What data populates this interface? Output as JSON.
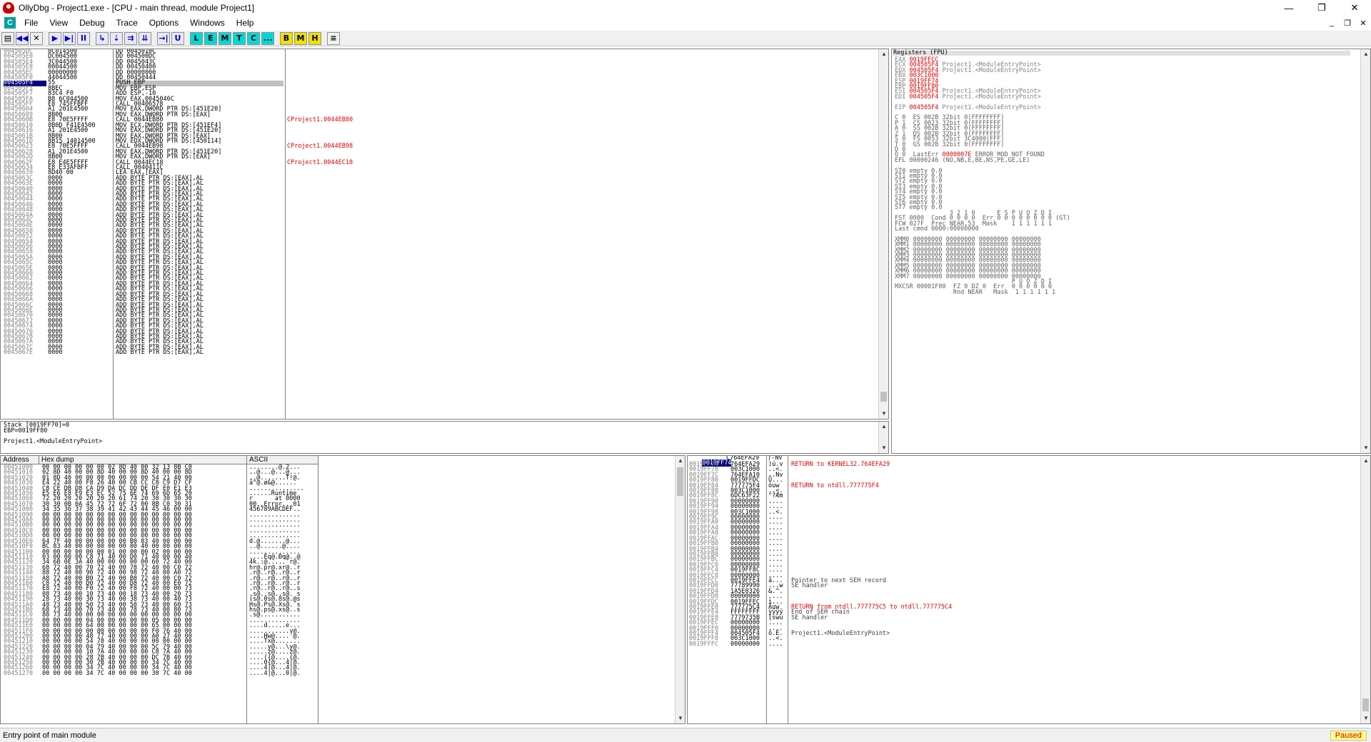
{
  "window": {
    "title": "OllyDbg - Project1.exe - [CPU - main thread, module Project1]"
  },
  "menu": [
    "File",
    "View",
    "Debug",
    "Trace",
    "Options",
    "Windows",
    "Help"
  ],
  "toolbar": {
    "blue": [
      "◀◀",
      "✕",
      "▶",
      "▶|",
      "II",
      "↳",
      "⇣",
      "⇉",
      "⇊",
      "→|",
      "U"
    ],
    "cyan": [
      "L",
      "E",
      "M",
      "T",
      "C",
      "..."
    ],
    "yellow": [
      "B",
      "M",
      "H"
    ],
    "list": "≡"
  },
  "cpu": {
    "current_address": "004505F4",
    "rows": [
      [
        "004505DC",
        "0C014500",
        "DD 0045010C",
        ""
      ],
      [
        "004505E0",
        "DC004500",
        "DD 004500DC",
        ""
      ],
      [
        "004505E4",
        "3C044500",
        "DD 0045043C",
        ""
      ],
      [
        "004505E8",
        "00044500",
        "DD 00450400",
        ""
      ],
      [
        "004505EC",
        "00000000",
        "DD 00000000",
        ""
      ],
      [
        "004505F0",
        "44044500",
        "DD 00450444",
        ""
      ],
      [
        "004505F4",
        "55",
        "PUSH EBP",
        ""
      ],
      [
        "004505F5",
        "8BEC",
        "MOV EBP,ESP",
        ""
      ],
      [
        "004505F7",
        "83C4 F0",
        "ADD ESP,-10",
        ""
      ],
      [
        "004505FA",
        "B8 6C044500",
        "MOV EAX,0045046C",
        ""
      ],
      [
        "004505FF",
        "E8 745FFBFF",
        "CALL 00406578",
        ""
      ],
      [
        "00450604",
        "A1 201E4500",
        "MOV EAX,DWORD PTR DS:[451E20]",
        ""
      ],
      [
        "00450609",
        "8B00",
        "MOV EAX,DWORD PTR DS:[EAX]",
        ""
      ],
      [
        "0045060B",
        "E8 70E5FFFF",
        "CALL 0044EB80",
        "Project1.0044EB80"
      ],
      [
        "00450610",
        "8B0D F41E4500",
        "MOV ECX,DWORD PTR DS:[451EF4]",
        ""
      ],
      [
        "00450616",
        "A1 201E4500",
        "MOV EAX,DWORD PTR DS:[451E20]",
        ""
      ],
      [
        "0045061B",
        "8B00",
        "MOV EAX,DWORD PTR DS:[EAX]",
        ""
      ],
      [
        "0045061D",
        "8B15 14014500",
        "MOV EDX,DWORD PTR DS:[450114]",
        ""
      ],
      [
        "00450623",
        "E8 70E5FFFF",
        "CALL 0044EB98",
        "Project1.0044EB98"
      ],
      [
        "00450628",
        "A1 201E4500",
        "MOV EAX,DWORD PTR DS:[451E20]",
        ""
      ],
      [
        "0045062D",
        "8B00",
        "MOV EAX,DWORD PTR DS:[EAX]",
        ""
      ],
      [
        "0045062F",
        "E8 E4E5FFFF",
        "CALL 0044EC18",
        "Project1.0044EC18"
      ],
      [
        "00450634",
        "E8 E33AFBFF",
        "CALL 0040411C",
        ""
      ],
      [
        "00450639",
        "8D40 00",
        "LEA EAX,[EAX]",
        ""
      ],
      [
        "0045063C",
        "0000",
        "ADD BYTE PTR DS:[EAX],AL",
        ""
      ],
      [
        "0045063E",
        "0000",
        "ADD BYTE PTR DS:[EAX],AL",
        ""
      ],
      [
        "00450640",
        "0000",
        "ADD BYTE PTR DS:[EAX],AL",
        ""
      ],
      [
        "00450642",
        "0000",
        "ADD BYTE PTR DS:[EAX],AL",
        ""
      ],
      [
        "00450644",
        "0000",
        "ADD BYTE PTR DS:[EAX],AL",
        ""
      ],
      [
        "00450646",
        "0000",
        "ADD BYTE PTR DS:[EAX],AL",
        ""
      ],
      [
        "00450648",
        "0000",
        "ADD BYTE PTR DS:[EAX],AL",
        ""
      ],
      [
        "0045064A",
        "0000",
        "ADD BYTE PTR DS:[EAX],AL",
        ""
      ],
      [
        "0045064C",
        "0000",
        "ADD BYTE PTR DS:[EAX],AL",
        ""
      ],
      [
        "0045064E",
        "0000",
        "ADD BYTE PTR DS:[EAX],AL",
        ""
      ],
      [
        "00450650",
        "0000",
        "ADD BYTE PTR DS:[EAX],AL",
        ""
      ],
      [
        "00450652",
        "0000",
        "ADD BYTE PTR DS:[EAX],AL",
        ""
      ],
      [
        "00450654",
        "0000",
        "ADD BYTE PTR DS:[EAX],AL",
        ""
      ],
      [
        "00450656",
        "0000",
        "ADD BYTE PTR DS:[EAX],AL",
        ""
      ],
      [
        "00450658",
        "0000",
        "ADD BYTE PTR DS:[EAX],AL",
        ""
      ],
      [
        "0045065A",
        "0000",
        "ADD BYTE PTR DS:[EAX],AL",
        ""
      ],
      [
        "0045065C",
        "0000",
        "ADD BYTE PTR DS:[EAX],AL",
        ""
      ],
      [
        "0045065E",
        "0000",
        "ADD BYTE PTR DS:[EAX],AL",
        ""
      ],
      [
        "00450660",
        "0000",
        "ADD BYTE PTR DS:[EAX],AL",
        ""
      ],
      [
        "00450662",
        "0000",
        "ADD BYTE PTR DS:[EAX],AL",
        ""
      ],
      [
        "00450664",
        "0000",
        "ADD BYTE PTR DS:[EAX],AL",
        ""
      ],
      [
        "00450666",
        "0000",
        "ADD BYTE PTR DS:[EAX],AL",
        ""
      ],
      [
        "00450668",
        "0000",
        "ADD BYTE PTR DS:[EAX],AL",
        ""
      ],
      [
        "0045066A",
        "0000",
        "ADD BYTE PTR DS:[EAX],AL",
        ""
      ],
      [
        "0045066C",
        "0000",
        "ADD BYTE PTR DS:[EAX],AL",
        ""
      ],
      [
        "0045066E",
        "0000",
        "ADD BYTE PTR DS:[EAX],AL",
        ""
      ],
      [
        "00450670",
        "0000",
        "ADD BYTE PTR DS:[EAX],AL",
        ""
      ],
      [
        "00450672",
        "0000",
        "ADD BYTE PTR DS:[EAX],AL",
        ""
      ],
      [
        "00450674",
        "0000",
        "ADD BYTE PTR DS:[EAX],AL",
        ""
      ],
      [
        "00450676",
        "0000",
        "ADD BYTE PTR DS:[EAX],AL",
        ""
      ],
      [
        "00450678",
        "0000",
        "ADD BYTE PTR DS:[EAX],AL",
        ""
      ],
      [
        "0045067A",
        "0000",
        "ADD BYTE PTR DS:[EAX],AL",
        ""
      ],
      [
        "0045067C",
        "0000",
        "ADD BYTE PTR DS:[EAX],AL",
        ""
      ],
      [
        "0045067E",
        "0000",
        "ADD BYTE PTR DS:[EAX],AL",
        ""
      ]
    ]
  },
  "info": {
    "lines": [
      "Stack [0019FF70]=0",
      "EBP=0019FF80",
      "",
      "Project1.<ModuleEntryPoint>"
    ]
  },
  "registers": {
    "header": "Registers (FPU)",
    "gp": [
      [
        "EAX",
        "0019FFCC",
        ""
      ],
      [
        "ECX",
        "004505F4",
        "Project1.<ModuleEntryPoint>"
      ],
      [
        "EDX",
        "004505F4",
        "Project1.<ModuleEntryPoint>"
      ],
      [
        "EBX",
        "003C1000",
        ""
      ],
      [
        "ESP",
        "0019FF74",
        ""
      ],
      [
        "EBP",
        "0019FF80",
        ""
      ],
      [
        "ESI",
        "004505F4",
        "Project1.<ModuleEntryPoint>"
      ],
      [
        "EDI",
        "004505F4",
        "Project1.<ModuleEntryPoint>"
      ]
    ],
    "eip": [
      "EIP",
      "004505F4",
      "Project1.<ModuleEntryPoint>"
    ],
    "flags": [
      "C 0  ES 002B 32bit 0(FFFFFFFF)",
      "P 1  CS 0023 32bit 0(FFFFFFFF)",
      "A 0  SS 002B 32bit 0(FFFFFFFF)",
      "Z 1  DS 002B 32bit 0(FFFFFFFF)",
      "S 0  FS 0053 32bit 3C4000(FFF)",
      "T 0  GS 002B 32bit 0(FFFFFFFF)",
      "D 0"
    ],
    "lasterr": {
      "prefix": "O 0  LastErr ",
      "code": "0000007E",
      "name": " ERROR_MOD_NOT_FOUND"
    },
    "efl": "EFL 00000246 (NO,NB,E,BE,NS,PE,GE,LE)",
    "st": [
      "ST0 empty 0.0",
      "ST1 empty 0.0",
      "ST2 empty 0.0",
      "ST3 empty 0.0",
      "ST4 empty 0.0",
      "ST5 empty 0.0",
      "ST6 empty 0.0",
      "ST7 empty 0.0"
    ],
    "fpu": [
      "               3 2 1 0      E S P U O Z D I",
      "FST 0000  Cond 0 0 0 0  Err 0 0 0 0 0 0 0 0 (GT)",
      "FCW 027F  Prec NEAR,53  Mask    1 1 1 1 1 1",
      "Last cmnd 0000:00000000"
    ],
    "xmm": [
      "XMM0 00000000 00000000 00000000 00000000",
      "XMM1 00000000 00000000 00000000 00000000",
      "XMM2 00000000 00000000 00000000 00000000",
      "XMM3 00000000 00000000 00000000 00000000",
      "XMM4 00000000 00000000 00000000 00000000",
      "XMM5 00000000 00000000 00000000 00000000",
      "XMM6 00000000 00000000 00000000 00000000",
      "XMM7 00000000 00000000 00000000 00000000"
    ],
    "mxcsr": [
      "                                P U O Z D I",
      "MXCSR 00001F80  FZ 0 DZ 0  Err  0 0 0 0 0 0",
      "                Rnd NEAR   Mask  1 1 1 1 1 1"
    ]
  },
  "dump": {
    "headers": [
      "Address",
      "Hex dump",
      "ASCII"
    ],
    "rows": [
      [
        "00451000",
        "00 00 00 00 00 00 02 8D 40 00 32 13 8B C0",
        "........@.2..."
      ],
      [
        "00451010",
        "02 8D 40 00 00 8D 40 00 00 8D 40 00 00 8D",
        "..@...@...@..."
      ],
      [
        "00451020",
        "01 8D 40 00 00 00 00 00 00 00 54 21 40 00",
        "..@.......T!@."
      ],
      [
        "00451030",
        "E4 22 40 00 F8 26 40 00 CB CC C8 C9 D7 CF",
        "ä\"@.ø&@......"
      ],
      [
        "00451040",
        "C8 CE DB D8 CA D9 DA DC DD DE DF E0 E1 E3",
        "..............."
      ],
      [
        "00451050",
        "E5 E6 E8 E9 E3 EC 52 75 6E 74 69 6D 65 20",
        "......Runtime "
      ],
      [
        "00451060",
        "72 20 20 20 20 20 20 61 74 20 30 30 30 30",
        "r      at 0000"
      ],
      [
        "00451070",
        "30 30 0B 0A 45 72 72 6F 72 00 8B C0 30 31",
        "00..Error...01"
      ],
      [
        "00451080",
        "34 35 36 37 38 39 41 42 43 44 45 46 00 00",
        "456789ABCDEF.."
      ],
      [
        "00451090",
        "00 00 00 00 00 00 00 00 00 00 00 00 00 00",
        ".............."
      ],
      [
        "004510A0",
        "00 00 00 00 00 00 00 00 00 00 00 00 00 00",
        ".............."
      ],
      [
        "004510B0",
        "00 00 00 00 00 00 00 00 00 00 00 00 00 00",
        ".............."
      ],
      [
        "004510C0",
        "00 00 00 00 00 00 00 00 00 00 00 00 00 00",
        ".............."
      ],
      [
        "004510D0",
        "00 00 00 00 00 00 00 00 00 00 00 00 00 00",
        ".............."
      ],
      [
        "004510E0",
        "64 7F 40 00 00 00 00 00 B0 83 40 00 00 00",
        "d.@.......@..."
      ],
      [
        "004510F0",
        "BC 83 40 00 00 00 00 00 00 40 00 00 00 00",
        "..@......@...."
      ],
      [
        "00451100",
        "00 00 00 00 00 00 01 00 00 00 02 00 00 00",
        ".............."
      ],
      [
        "00451110",
        "03 00 00 00 C8 71 40 00 D0 71 40 00 00 40",
        "....Èq@.Ðq@..@"
      ],
      [
        "00451120",
        "34 6B 0E 3A 40 00 00 00 00 00 60 72 40 00",
        "4k.:@.....`r@."
      ],
      [
        "00451130",
        "68 72 40 00 70 72 40 00 78 72 40 00 C0 72",
        "hr@.pr@.xr@..r"
      ],
      [
        "00451140",
        "88 72 40 00 90 72 40 00 98 72 40 00 A0 72",
        ".r@..r@..r@..r"
      ],
      [
        "00451150",
        "A8 72 40 00 B0 72 40 00 B8 72 40 00 C0 72",
        ".r@..r@..r@..r"
      ],
      [
        "00451160",
        "C8 72 40 00 D0 72 40 00 D8 72 40 00 E0 72",
        ".r@..r@..r@..r"
      ],
      [
        "00451170",
        "E8 72 40 00 F0 72 40 00 F8 72 40 00 00 73",
        ".r@..r@..r@..s"
      ],
      [
        "00451180",
        "08 73 40 00 10 73 40 00 18 73 40 00 20 73",
        ".s@..s@..s@. s"
      ],
      [
        "00451190",
        "28 73 40 00 30 73 40 00 38 73 40 00 40 73",
        "(s@.0s@.8s@.@s"
      ],
      [
        "004511A0",
        "48 73 40 00 50 73 40 00 58 73 40 00 60 73",
        "Hs@.Ps@.Xs@.`s"
      ],
      [
        "004511B0",
        "68 73 40 00 70 73 40 00 78 73 40 00 80 73",
        "hs@.ps@.xs@..s"
      ],
      [
        "004511C0",
        "88 73 40 00 00 00 00 00 00 00 00 00 00 00",
        ".s@..........."
      ],
      [
        "004511D0",
        "00 00 00 00 04 00 00 00 00 00 05 00 00 00",
        ".............."
      ],
      [
        "004511E0",
        "00 00 00 00 64 00 00 00 00 00 65 00 00 00",
        "....d.....e..."
      ],
      [
        "004511F0",
        "00 00 00 00 00 00 00 00 00 00 F0 76 40 00",
        "...........v@."
      ],
      [
        "00451200",
        "00 00 00 00 48 77 40 00 00 00 A0 27 40 00",
        "....Hw@....'@."
      ],
      [
        "00451210",
        "00 00 00 00 54 78 40 00 00 00 00 00 00 00",
        "....Tx@......."
      ],
      [
        "00451220",
        "00 00 00 00 04 79 40 00 00 00 5C 79 40 00",
        ".....y@...\\y@."
      ],
      [
        "00451230",
        "00 00 00 00 10 7A 40 00 00 00 C8 7A 40 00",
        ".....z@....z@."
      ],
      [
        "00451240",
        "00 00 00 00 28 7B 40 00 00 00 DC 7B 40 00",
        "....({@....{@."
      ],
      [
        "00451250",
        "00 00 00 00 30 7B 40 00 00 00 34 7C 40 00",
        "....0{@...4|@."
      ],
      [
        "00451260",
        "00 00 00 00 34 7C 40 00 00 00 34 7C 40 00",
        "....4|@...4|@."
      ],
      [
        "00451270",
        "00 00 00 00 34 7C 40 00 00 00 30 7C 40 00",
        "....4|@...0|@."
      ]
    ]
  },
  "stack": {
    "header": [
      "0019FF74",
      "C764EFA29",
      ")-Nv"
    ],
    "rows": [
      [
        "0019FF74",
        "764EFA29",
        ")ú.v",
        "RETURN to KERNEL32.764EFA29",
        true
      ],
      [
        "0019FF78",
        "003C1000",
        "..<.",
        "",
        false
      ],
      [
        "0019FF7C",
        "764EFA10",
        "..Nv",
        "",
        false
      ],
      [
        "0019FF80",
        "0019FFDC",
        "Ü...",
        "",
        false
      ],
      [
        "0019FF84",
        "777775F4",
        "ôuw",
        "RETURN to ntdll.777775F4",
        true
      ],
      [
        "0019FF88",
        "003C1000",
        "..<.",
        "",
        false
      ],
      [
        "0019FF8C",
        "6DC63F22",
        "\"?Æm",
        "",
        false
      ],
      [
        "0019FF90",
        "00000000",
        "....",
        "",
        false
      ],
      [
        "0019FF94",
        "00000000",
        "....",
        "",
        false
      ],
      [
        "0019FF98",
        "003C1000",
        "..<.",
        "",
        false
      ],
      [
        "0019FF9C",
        "00000000",
        "....",
        "",
        false
      ],
      [
        "0019FFA0",
        "00000000",
        "....",
        "",
        false
      ],
      [
        "0019FFA4",
        "00000000",
        "....",
        "",
        false
      ],
      [
        "0019FFA8",
        "00000000",
        "....",
        "",
        false
      ],
      [
        "0019FFAC",
        "00000000",
        "....",
        "",
        false
      ],
      [
        "0019FFB0",
        "00000000",
        "....",
        "",
        false
      ],
      [
        "0019FFB4",
        "00000000",
        "....",
        "",
        false
      ],
      [
        "0019FFB8",
        "00000000",
        "....",
        "",
        false
      ],
      [
        "0019FFBC",
        "00000000",
        "....",
        "",
        false
      ],
      [
        "0019FFC0",
        "00000000",
        "....",
        "",
        false
      ],
      [
        "0019FFC4",
        "0019FF8C",
        "....",
        "",
        false
      ],
      [
        "0019FFC8",
        "00000000",
        "....",
        "",
        false
      ],
      [
        "0019FFCC",
        "0019FFE4",
        "ä...",
        "Pointer to next SEH record",
        false
      ],
      [
        "0019FFD0",
        "77789990",
        "...w",
        "SE handler",
        false
      ],
      [
        "0019FFD4",
        "1A5E0326",
        "&.^.",
        "",
        false
      ],
      [
        "0019FFD8",
        "00000000",
        "....",
        "",
        false
      ],
      [
        "0019FFDC",
        "0019FFEC",
        "ì...",
        "",
        false
      ],
      [
        "0019FFE0",
        "777775C4",
        "Äuw",
        "RETURN from ntdll.777775C5 to ntdll.777775C4",
        true
      ],
      [
        "0019FFE4",
        "FFFFFFFF",
        "ÿÿÿÿ",
        "End of SEH chain",
        false
      ],
      [
        "0019FFE8",
        "7779735B",
        "[swu",
        "SE handler",
        false
      ],
      [
        "0019FFEC",
        "00000000",
        "....",
        "",
        false
      ],
      [
        "0019FFF0",
        "00000000",
        "....",
        "",
        false
      ],
      [
        "0019FFF4",
        "004505F4",
        "ô.E.",
        "Project1.<ModuleEntryPoint>",
        false
      ],
      [
        "0019FFF8",
        "003C1000",
        "..<.",
        "",
        false
      ],
      [
        "0019FFFC",
        "00000000",
        "....",
        "",
        false
      ]
    ]
  },
  "status": {
    "text": "Entry point of main module",
    "state": "Paused"
  }
}
